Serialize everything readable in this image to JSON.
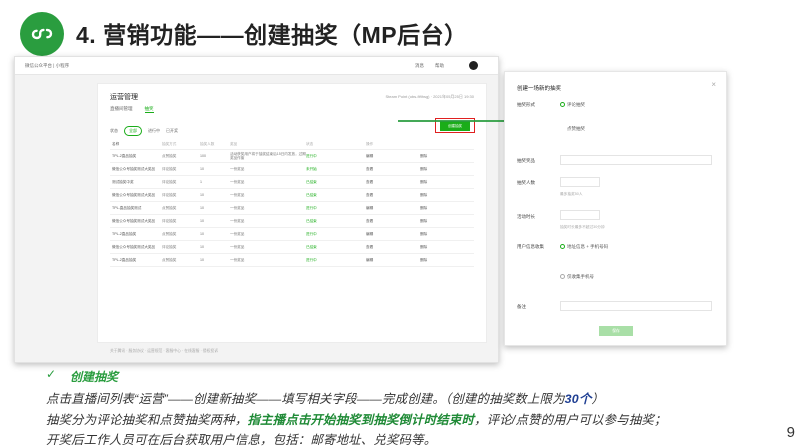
{
  "header": {
    "title": "4. 营销功能——创建抽奖（MP后台）"
  },
  "left_screenshot": {
    "brand": "微信公众平台 | 小程序",
    "top_right": [
      "消息",
      "帮助"
    ],
    "card_title": "运营管理",
    "card_meta": "Steam Point (obs-fifthsg) · 2021年05月25日 19:30",
    "tabs": [
      "直播间管理",
      "抽奖"
    ],
    "filters": [
      "全部",
      "进行中",
      "已开奖"
    ],
    "filter_label": "状态",
    "create_button": "创建抽奖",
    "table": {
      "headers": [
        "名称",
        "抽奖方式",
        "抽奖人数",
        "奖品",
        "状态",
        "操作",
        ""
      ],
      "rows": [
        [
          "TPL-2直品抽奖",
          "点赞抽奖",
          "100",
          "活动获奖用户将于抽奖结束后15日内发放，过期奖品作废",
          "进行中",
          "编辑",
          "删除"
        ],
        [
          "微信公众号抽奖测试大奖品",
          "评论抽奖",
          "10",
          "一份奖品",
          "未开始",
          "查看",
          "删除"
        ],
        [
          "测试抽奖中奖",
          "评论抽奖",
          "1",
          "一份奖品",
          "已结束",
          "查看",
          "删除"
        ],
        [
          "微信公众号抽奖测试大奖品",
          "评论抽奖",
          "10",
          "一份奖品",
          "已结束",
          "查看",
          "删除"
        ],
        [
          "TPL-直品抽奖测试",
          "点赞抽奖",
          "10",
          "一份奖品",
          "进行中",
          "编辑",
          "删除"
        ],
        [
          "微信公众号抽奖测试大奖品",
          "评论抽奖",
          "10",
          "一份奖品",
          "已结束",
          "查看",
          "删除"
        ],
        [
          "TPL-2直品抽奖",
          "点赞抽奖",
          "10",
          "一份奖品",
          "进行中",
          "编辑",
          "删除"
        ],
        [
          "微信公众号抽奖测试大奖品",
          "评论抽奖",
          "10",
          "一份奖品",
          "已结束",
          "查看",
          "删除"
        ],
        [
          "TPL-2直品抽奖",
          "点赞抽奖",
          "10",
          "一份奖品",
          "进行中",
          "编辑",
          "删除"
        ]
      ]
    },
    "footer": "关于腾讯 · 服务协议 · 运营规范 · 客服中心 · 在线客服 · 侵权投诉"
  },
  "dialog": {
    "title": "创建一场新的抽奖",
    "close": "×",
    "fields": [
      {
        "label": "抽奖形式",
        "options": [
          "评论抽奖",
          "点赞抽奖"
        ]
      },
      {
        "label": "抽奖奖品"
      },
      {
        "label": "抽奖人数",
        "hint": "最多抽奖50人"
      },
      {
        "label": "活动时长",
        "hint": "抽奖时长最多不超过30分钟"
      },
      {
        "label": "用户信息收集",
        "options": [
          "地址信息 + 手机号码",
          "仅收集手机号"
        ]
      },
      {
        "label": "备注"
      }
    ],
    "submit": "保存"
  },
  "body_text": {
    "check": "✓",
    "subtitle": "创建抽奖",
    "line1_a": "点击直播间列表“运营”——创建新抽奖——填写相关字段——完成创建。（创建的抽奖数上限为",
    "line1_b": "30个",
    "line1_c": "）",
    "line2_a": "抽奖分为评论抽奖和点赞抽奖两种，",
    "line2_b": "指主播点击开始抽奖到抽奖倒计时结束时",
    "line2_c": "，评论/点赞的用户可以参与抽奖；",
    "line3": "开奖后工作人员可在后台获取用户信息，包括：邮寄地址、兑奖码等。"
  },
  "page_number": "9",
  "colors": {
    "brand_green": "#2a9d3f",
    "highlight_red": "#e02020",
    "accent_blue": "#1f3f93"
  }
}
